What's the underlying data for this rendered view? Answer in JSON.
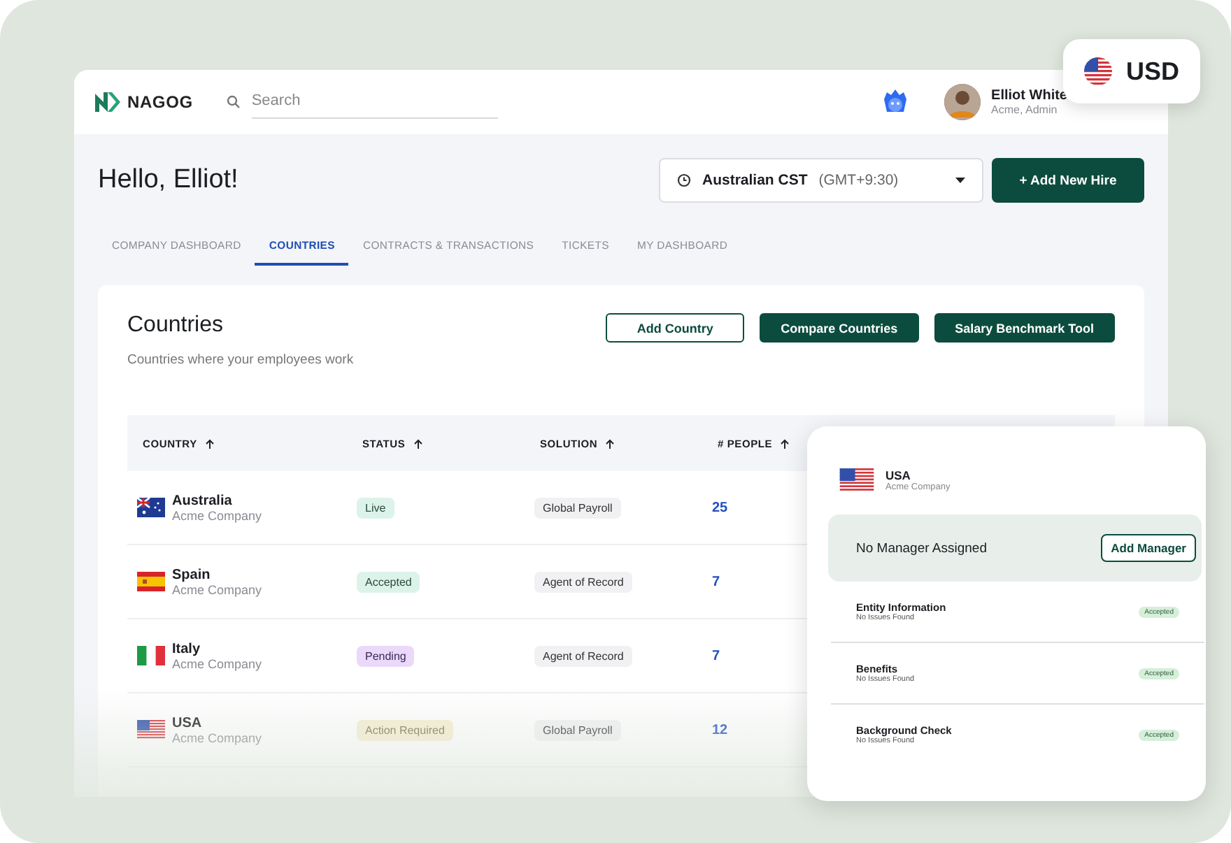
{
  "header": {
    "logo": "NAGOG",
    "search": {
      "placeholder": "Search"
    },
    "user": {
      "name": "Elliot White",
      "role": "Acme, Admin"
    }
  },
  "currency": {
    "code": "USD"
  },
  "greeting": "Hello, Elliot!",
  "timezone": {
    "name": "Australian CST",
    "offset": "(GMT+9:30)"
  },
  "add_hire_button": "+ Add New Hire",
  "tabs": [
    {
      "label": "COMPANY DASHBOARD",
      "selected": false
    },
    {
      "label": "COUNTRIES",
      "selected": true
    },
    {
      "label": "CONTRACTS & TRANSACTIONS",
      "selected": false
    },
    {
      "label": "TICKETS",
      "selected": false
    },
    {
      "label": "MY DASHBOARD",
      "selected": false
    }
  ],
  "section": {
    "title": "Countries",
    "subtitle": "Countries where your employees work",
    "buttons": [
      {
        "label": "Add Country",
        "kind": "outline"
      },
      {
        "label": "Compare Countries",
        "kind": "solid"
      },
      {
        "label": "Salary Benchmark Tool",
        "kind": "solid"
      }
    ]
  },
  "table": {
    "columns": [
      "COUNTRY",
      "STATUS",
      "SOLUTION",
      "# PEOPLE"
    ],
    "rows": [
      {
        "flag": {
          "kind": "au"
        },
        "country": "Australia",
        "company": "Acme Company",
        "status": {
          "label": "Live",
          "kind": "success"
        },
        "solution": "Global Payroll",
        "people": "25"
      },
      {
        "flag": {
          "kind": "es"
        },
        "country": "Spain",
        "company": "Acme Company",
        "status": {
          "label": "Accepted",
          "kind": "success"
        },
        "solution": "Agent of Record",
        "people": "7"
      },
      {
        "flag": {
          "kind": "it"
        },
        "country": "Italy",
        "company": "Acme Company",
        "status": {
          "label": "Pending",
          "kind": "pending"
        },
        "solution": "Agent of Record",
        "people": "7"
      },
      {
        "flag": {
          "kind": "us"
        },
        "country": "USA",
        "company": "Acme Company",
        "status": {
          "label": "Action Required",
          "kind": "warning"
        },
        "solution": "Global Payroll",
        "people": "12"
      }
    ]
  },
  "detail_panel": {
    "flag": {
      "kind": "us"
    },
    "country": "USA",
    "company": "Acme Company",
    "manager_text": "No Manager Assigned",
    "manager_button": "Add Manager",
    "checks": [
      {
        "title": "Entity Information",
        "note": "No Issues Found",
        "status": "Accepted"
      },
      {
        "title": "Benefits",
        "note": "No Issues Found",
        "status": "Accepted"
      },
      {
        "title": "Background Check",
        "note": "No Issues Found",
        "status": "Accepted"
      }
    ]
  }
}
